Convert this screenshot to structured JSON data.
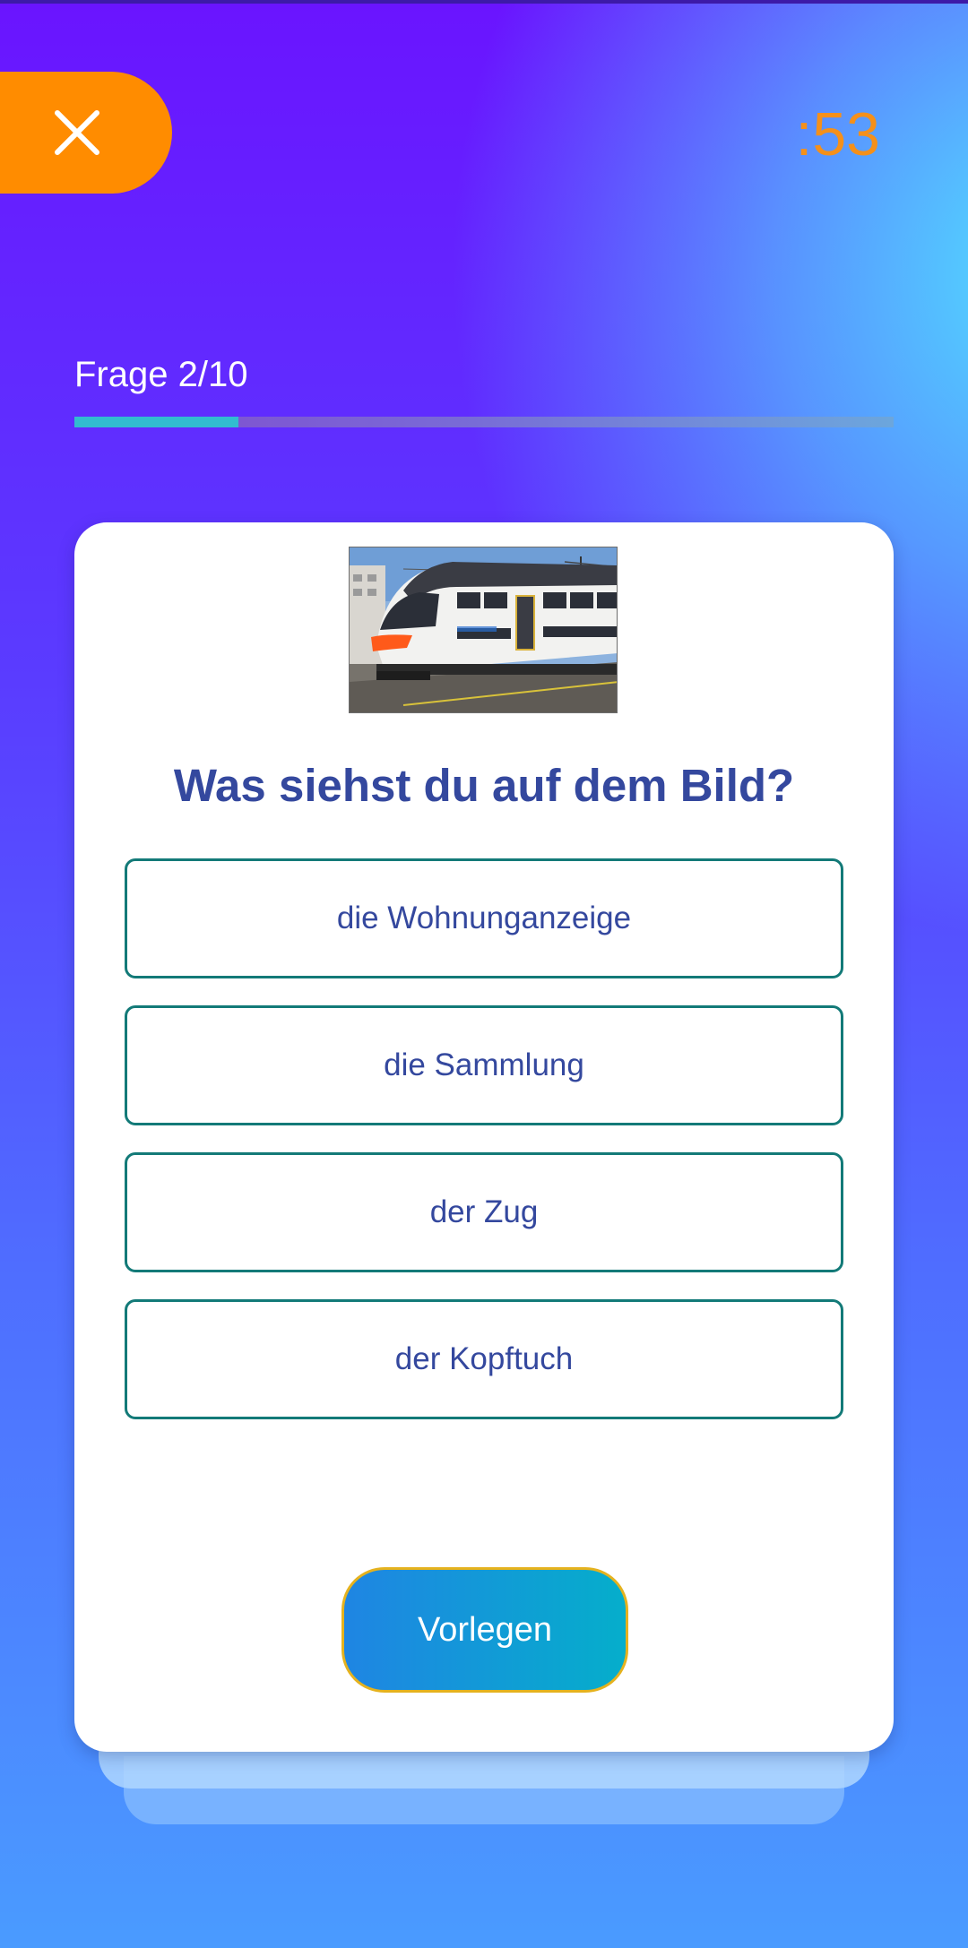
{
  "header": {
    "close_icon": "close-icon",
    "timer": ":53"
  },
  "progress": {
    "label": "Frage 2/10",
    "current": 2,
    "total": 10,
    "fraction": 0.2
  },
  "quiz": {
    "image": "train-photo",
    "question": "Was siehst du auf dem Bild?",
    "options": [
      {
        "label": "die Wohnunganzeige"
      },
      {
        "label": "die Sammlung"
      },
      {
        "label": "der Zug"
      },
      {
        "label": "der Kopftuch"
      }
    ],
    "submit_label": "Vorlegen"
  },
  "colors": {
    "accent_orange": "#ff8c00",
    "timer_orange": "#f5901a",
    "question_text": "#34489e",
    "option_border": "#137a78",
    "progress_fill": "#2ad6c8",
    "submit_border": "#e5b21e"
  }
}
